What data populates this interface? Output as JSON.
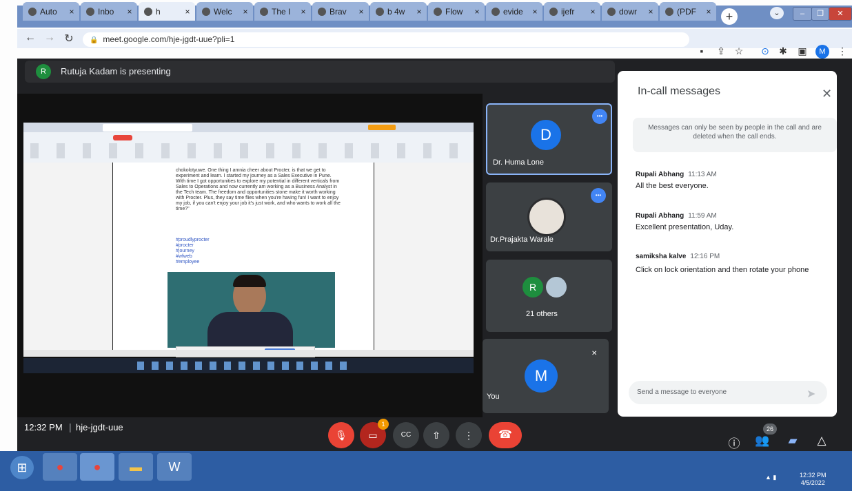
{
  "browser": {
    "tabs": [
      {
        "title": "Auto",
        "icon": "github-icon"
      },
      {
        "title": "Inbo",
        "prefix": "M",
        "icon": "gmail-icon"
      },
      {
        "title": "h",
        "icon": "meet-icon",
        "active": true
      },
      {
        "title": "Welc",
        "icon": "page-icon"
      },
      {
        "title": "The I",
        "icon": "page-icon"
      },
      {
        "title": "Brav",
        "icon": "page-icon"
      },
      {
        "title": "b 4w",
        "icon": "github-icon"
      },
      {
        "title": "Flow",
        "icon": "github-icon"
      },
      {
        "title": "evide",
        "icon": "google-icon"
      },
      {
        "title": "ijefr",
        "icon": "github-icon"
      },
      {
        "title": "dowr",
        "icon": "page-icon"
      },
      {
        "title": "(PDF",
        "icon": "page-icon"
      }
    ],
    "tab_close": "×",
    "new_tab": "+",
    "url": "meet.google.com/hje-jgdt-uue?pli=1",
    "avatar_letter": "M"
  },
  "meet": {
    "presenter_initial": "R",
    "presenting_text": "Rutuja Kadam is presenting",
    "doc": {
      "paragraph": "chokolotyuwe. One thing I amnia cheer about Procter, is that we get to experiment and learn. I started my journey as a Sales Executive in Pune. With time I got opportunities to explore my potential in different verticals from Sales to Operations and now currently am working as a Business Analyst in the Tech team. The freedom and opportunities stone make it worth working with Procter. Plus, they say time flies when you're having fun! I want to enjoy my job, if you can't enjoy your job it's just work, and who wants to work all the time?\"",
      "hashtags": [
        "#proudlyprocter",
        "#procter",
        "#journey",
        "#wfweb",
        "#employee"
      ]
    },
    "participants": [
      {
        "name": "Dr. Huma Lone",
        "initial": "D",
        "color": "#1a73e8"
      },
      {
        "name": "Dr.Prajakta Warale",
        "initial": "",
        "color": "#3c4043"
      },
      {
        "name": "21 others",
        "initial": "R",
        "color": "#1e8e3e"
      },
      {
        "name": "You",
        "initial": "M",
        "color": "#1a73e8"
      }
    ],
    "chat": {
      "title": "In-call messages",
      "notice": "Messages can only be seen by people in the call and are deleted when the call ends.",
      "messages": [
        {
          "sender": "Rupali Abhang",
          "time": "11:13 AM",
          "text": "All the best everyone."
        },
        {
          "sender": "Rupali Abhang",
          "time": "11:59 AM",
          "text": "Excellent presentation, Uday."
        },
        {
          "sender": "samiksha kalve",
          "time": "12:16 PM",
          "text": "Click on lock orientation and then rotate your phone"
        }
      ],
      "input_placeholder": "Send a message to everyone"
    },
    "bottom": {
      "time": "12:32 PM",
      "separator": "|",
      "meeting_code": "hje-jgdt-uue",
      "participant_count": "26",
      "raise_badge": "1"
    }
  },
  "taskbar": {
    "time": "12:32 PM",
    "date": "4/5/2022"
  }
}
